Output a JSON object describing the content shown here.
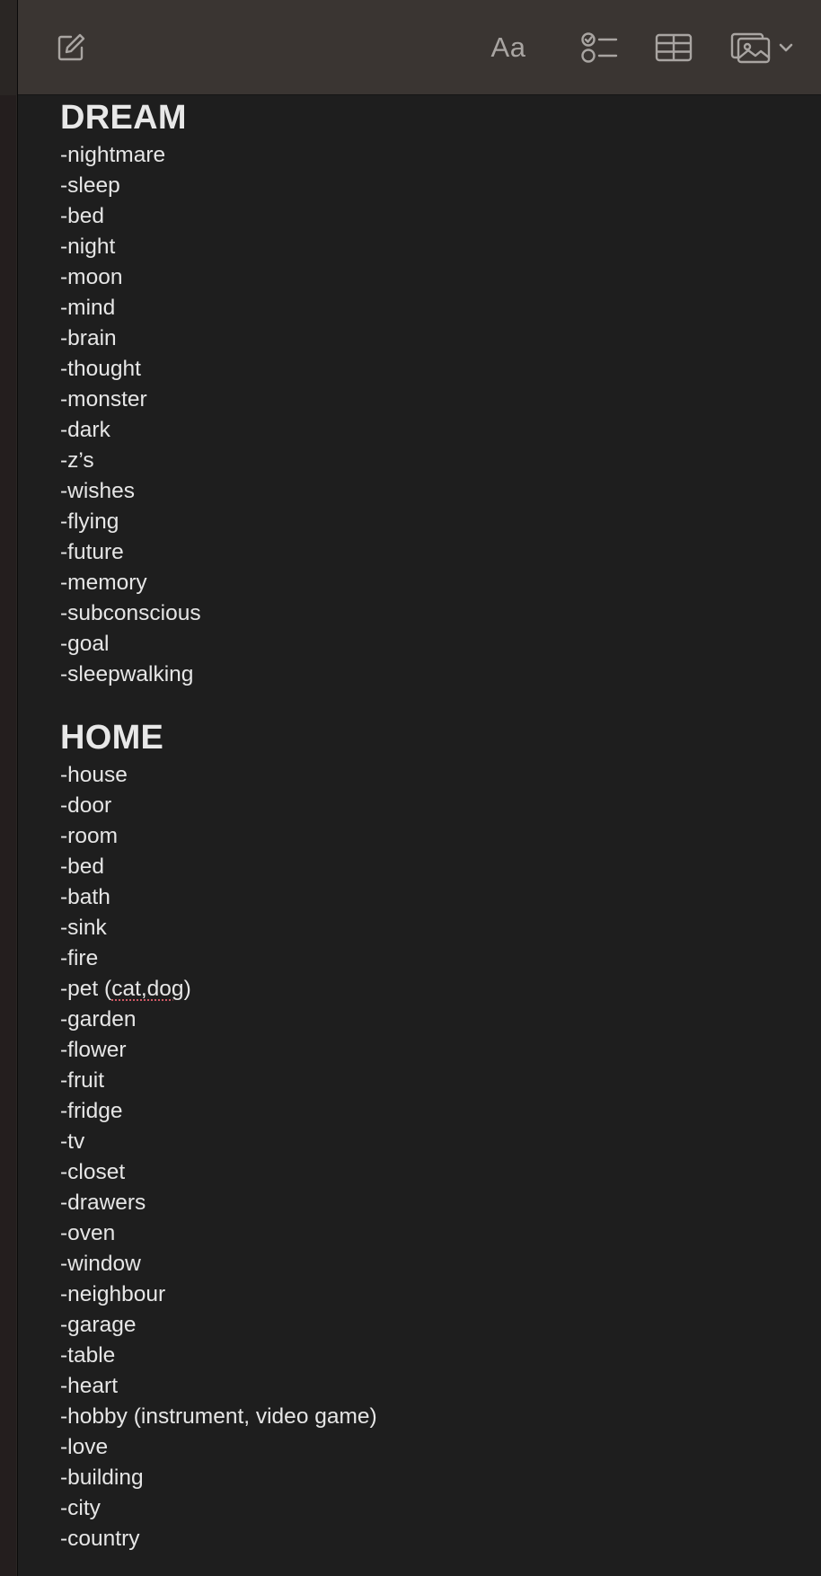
{
  "toolbar": {
    "format_label": "Aa",
    "icons": [
      "compose-icon",
      "checklist-icon",
      "table-icon",
      "media-icon",
      "chevron-down-icon"
    ]
  },
  "note": {
    "section1_title": "DREAM",
    "section1_items": [
      "-nightmare",
      "-sleep",
      "-bed",
      "-night",
      "-moon",
      "-mind",
      "-brain",
      "-thought",
      "-monster",
      "-dark",
      "-z’s",
      "-wishes",
      "-flying",
      "-future",
      "-memory",
      "-subconscious",
      "-goal",
      "-sleepwalking"
    ],
    "section2_title": "HOME",
    "section2_items": [
      "-house",
      "-door",
      "-room",
      "-bed",
      "-bath",
      "-sink",
      "-fire",
      "-pet (",
      "cat,dog",
      ")",
      "-garden",
      "-flower",
      "-fruit",
      "-fridge",
      "-tv",
      "-closet",
      "-drawers",
      "-oven",
      "-window",
      "-neighbour",
      "-garage",
      "-table",
      "-heart",
      "-hobby (instrument, video game)",
      "-love",
      "-building",
      "-city",
      "-country"
    ]
  },
  "colors": {
    "background": "#1e1e1e",
    "toolbar": "#3a3532",
    "text": "#e6e6e6",
    "icon": "#a9a5a2",
    "spellcheck_underline": "#d05a66"
  }
}
